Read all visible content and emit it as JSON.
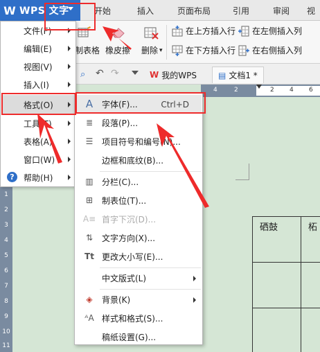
{
  "titlebar": {
    "app_logo": "W",
    "app_name": "WPS 文字",
    "tabs": [
      "开始",
      "插入",
      "页面布局",
      "引用",
      "审阅",
      "视"
    ]
  },
  "ribbon": {
    "draw_table": "制表格",
    "eraser": "橡皮擦",
    "delete": "删除",
    "insert_above": "在上方插入行",
    "insert_below": "在下方插入行",
    "insert_left": "在左侧插入列",
    "insert_right": "在右侧插入列"
  },
  "quickbar": {
    "my_wps": "我的WPS",
    "doc_tab": "文档1 *"
  },
  "ruler": {
    "h_numbers": [
      "4",
      "2",
      "2",
      "4",
      "6"
    ],
    "v_numbers": [
      "1",
      "2",
      "3",
      "4",
      "5",
      "6",
      "7",
      "8",
      "9",
      "10",
      "11"
    ]
  },
  "document": {
    "cell_1": "硒鼓",
    "cell_2": "柘"
  },
  "main_menu": {
    "items": [
      {
        "label": "文件(F)"
      },
      {
        "label": "编辑(E)"
      },
      {
        "label": "视图(V)"
      },
      {
        "label": "插入(I)"
      },
      {
        "label": "格式(O)"
      },
      {
        "label": "工具(T)"
      },
      {
        "label": "表格(A)"
      },
      {
        "label": "窗口(W)"
      },
      {
        "label": "帮助(H)"
      }
    ]
  },
  "format_menu": {
    "items": [
      {
        "label": "字体(F)...",
        "shortcut": "Ctrl+D",
        "icon": "font-icon"
      },
      {
        "label": "段落(P)...",
        "icon": "paragraph-icon"
      },
      {
        "label": "项目符号和编号(N)...",
        "icon": "bullet-list-icon"
      },
      {
        "label": "边框和底纹(B)..."
      },
      {
        "label": "分栏(C)...",
        "icon": "columns-icon"
      },
      {
        "label": "制表位(T)...",
        "icon": "tab-stop-icon"
      },
      {
        "label": "首字下沉(D)...",
        "icon": "drop-cap-icon",
        "disabled": true
      },
      {
        "label": "文字方向(X)...",
        "icon": "text-direction-icon"
      },
      {
        "label": "更改大小写(E)...",
        "icon": "change-case-icon"
      },
      {
        "label": "中文版式(L)"
      },
      {
        "label": "背景(K)",
        "icon": "background-icon"
      },
      {
        "label": "样式和格式(S)...",
        "icon": "styles-icon"
      },
      {
        "label": "稿纸设置(G)..."
      }
    ]
  },
  "colors": {
    "brand_blue": "#2f6fc8",
    "annotation_red": "#ee2b2b",
    "doc_green": "#d5e6d5"
  }
}
